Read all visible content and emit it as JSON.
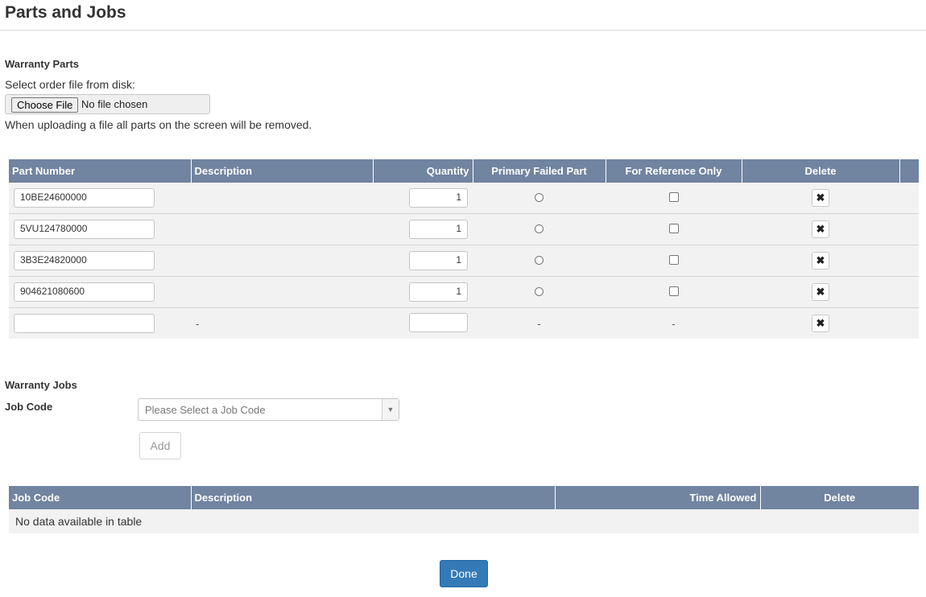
{
  "header": {
    "title": "Parts and Jobs"
  },
  "warranty_parts": {
    "title": "Warranty Parts",
    "upload_label": "Select order file from disk:",
    "choose_file_label": "Choose File",
    "file_status": "No file chosen",
    "upload_note": "When uploading a file all parts on the screen will be removed.",
    "columns": [
      "Part Number",
      "Description",
      "Quantity",
      "Primary Failed Part",
      "For Reference Only",
      "Delete"
    ],
    "rows": [
      {
        "part_number": "10BE24600000",
        "description": "",
        "quantity": "1"
      },
      {
        "part_number": "5VU124780000",
        "description": "",
        "quantity": "1"
      },
      {
        "part_number": "3B3E24820000",
        "description": "",
        "quantity": "1"
      },
      {
        "part_number": "904621080600",
        "description": "",
        "quantity": "1"
      }
    ],
    "empty_row": {
      "placeholder": "-"
    },
    "delete_icon": "✖"
  },
  "warranty_jobs": {
    "title": "Warranty Jobs",
    "job_code_label": "Job Code",
    "job_code_placeholder": "Please Select a Job Code",
    "add_label": "Add",
    "columns": [
      "Job Code",
      "Description",
      "Time Allowed",
      "Delete"
    ],
    "empty_message": "No data available in table"
  },
  "footer": {
    "done_label": "Done"
  },
  "colors": {
    "header_bg": "#7184a0",
    "primary": "#337ab7",
    "row_bg": "#f2f2f2"
  }
}
